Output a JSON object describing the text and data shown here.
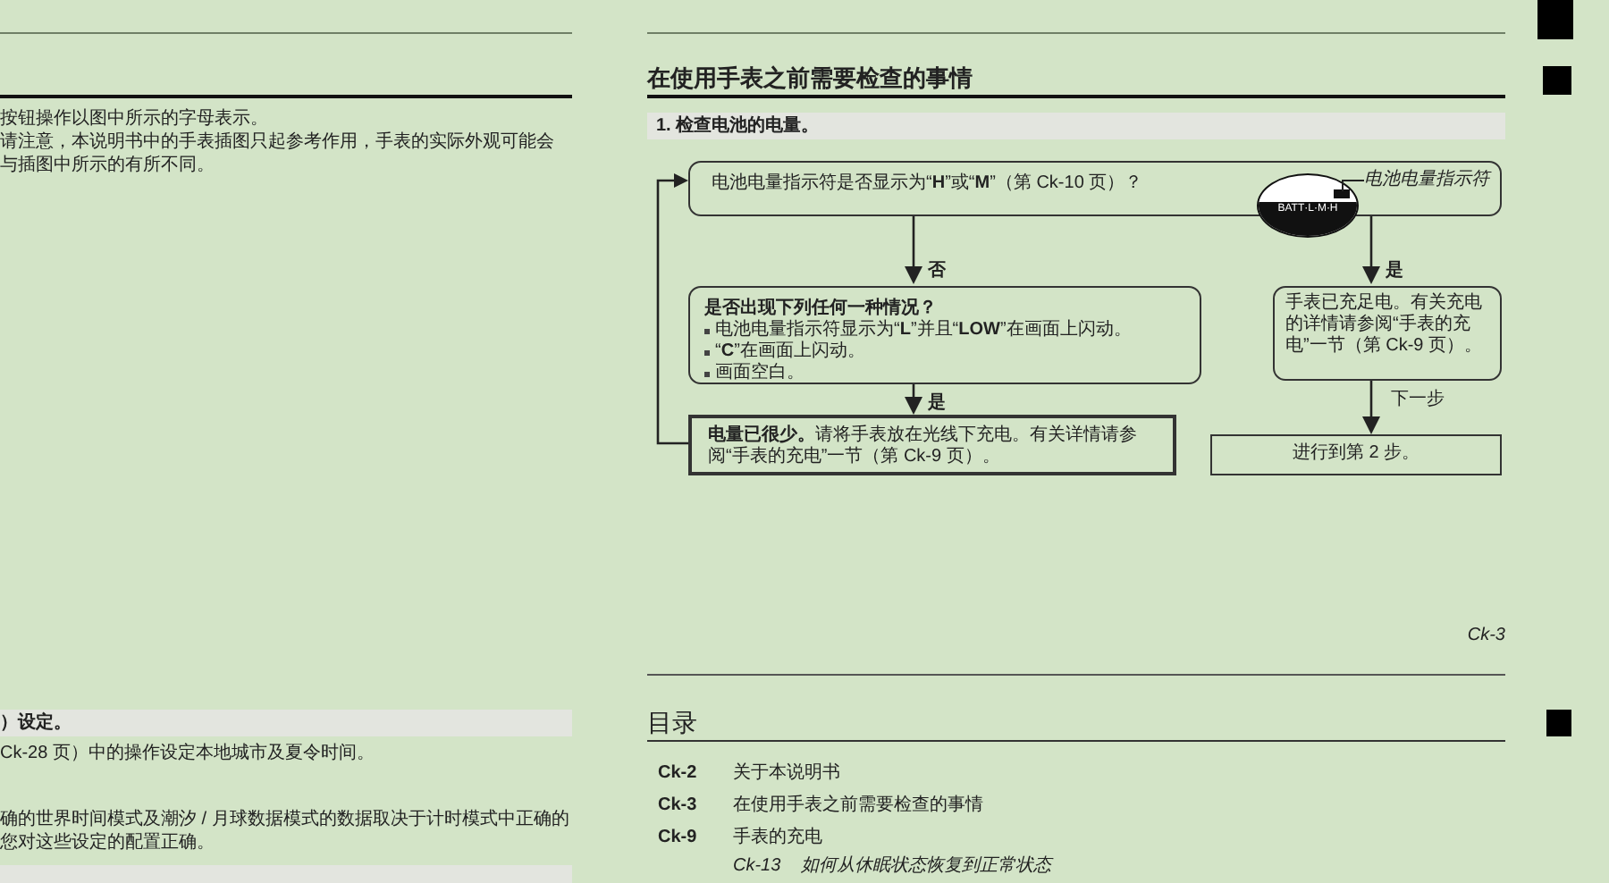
{
  "left_column": {
    "intro_lines": [
      "按钮操作以图中所示的字母表示。",
      "请注意，本说明书中的手表插图只起参考作用，手表的实际外观可能会",
      "与插图中所示的有所不同。"
    ],
    "section_heading": "）设定。",
    "instruction": "Ck-28 页）中的操作设定本地城市及夏令时间。",
    "note_lines": [
      "确的世界时间模式及潮汐 / 月球数据模式的数据取决于计时模式中正确的",
      "您对这些设定的配置正确。"
    ]
  },
  "right_column": {
    "title": "在使用手表之前需要检查的事情",
    "step": "1. 检查电池的电量。",
    "flowchart": {
      "question_box": "电池电量指示符是否显示为“**H**”或“**M**”（第 Ck-10 页）？",
      "watch_display": "BATT·L·M·H",
      "indicator_label": "电池电量指示符",
      "no_label": "否",
      "yes_label": "是",
      "conditions": {
        "title": "是否出现下列任何一种情况？",
        "items": [
          "电池电量指示符显示为“**L**”并且“**LOW**”在画面上闪动。",
          "“**C**”在画面上闪动。",
          "画面空白。"
        ]
      },
      "charged_box": "手表已充足电。有关充电的详情请参阅“手表的充电”一节（第 Ck-9 页）。",
      "yes_label_2": "是",
      "low_box": "**电量已很少。**请将手表放在光线下充电。有关详情请参阅“手表的充电”一节（第 Ck-9 页）。",
      "next_label": "下一步",
      "proceed_box": "进行到第 2 步。"
    },
    "page_number": "Ck-3",
    "toc": {
      "title": "目录",
      "entries": [
        {
          "page": "Ck-2",
          "title": "关于本说明书"
        },
        {
          "page": "Ck-3",
          "title": "在使用手表之前需要检查的事情"
        },
        {
          "page": "Ck-9",
          "title": "手表的充电",
          "children": [
            {
              "page": "Ck-13",
              "title": "如何从休眠状态恢复到正常状态"
            }
          ]
        }
      ]
    }
  }
}
